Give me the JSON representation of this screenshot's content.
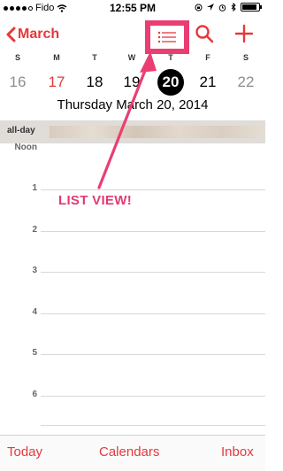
{
  "status_bar": {
    "carrier": "Fido",
    "time": "12:55 PM",
    "signal_bars": 4
  },
  "nav": {
    "back_label": "March",
    "list_button_icon": "list-icon",
    "search_icon": "search-icon",
    "add_icon": "plus-icon"
  },
  "week": {
    "days": [
      {
        "dow": "S",
        "num": "16"
      },
      {
        "dow": "M",
        "num": "17"
      },
      {
        "dow": "T",
        "num": "18"
      },
      {
        "dow": "W",
        "num": "19"
      },
      {
        "dow": "T",
        "num": "20"
      },
      {
        "dow": "F",
        "num": "21"
      },
      {
        "dow": "S",
        "num": "22"
      }
    ],
    "selected_date_title": "Thursday  March 20, 2014"
  },
  "allday": {
    "label": "all-day"
  },
  "timeline": {
    "hours": [
      "Noon",
      "1",
      "2",
      "3",
      "4",
      "5",
      "6"
    ]
  },
  "annotation": {
    "text": "LIST VIEW!"
  },
  "toolbar": {
    "today": "Today",
    "calendars": "Calendars",
    "inbox": "Inbox"
  },
  "colors": {
    "accent": "#e5383b",
    "annotation": "#ea3e72",
    "today_circle": "#000000"
  }
}
